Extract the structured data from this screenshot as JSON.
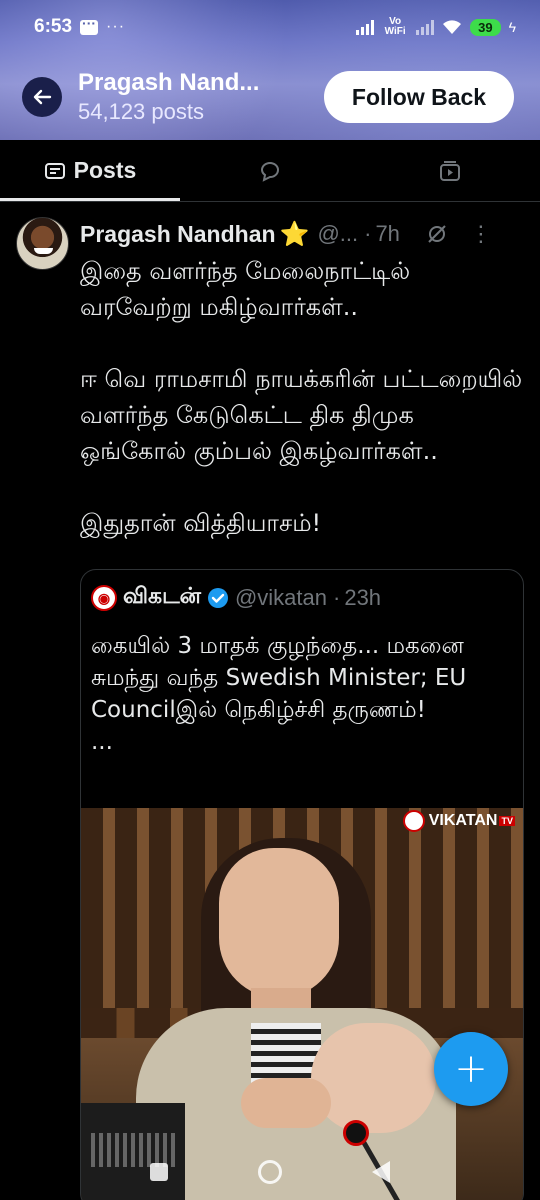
{
  "status_bar": {
    "time": "6:53",
    "network_label": "Vo WiFi",
    "battery": "39"
  },
  "header": {
    "profile_name": "Pragash Nand...",
    "post_count": "54,123 posts",
    "follow_label": "Follow Back"
  },
  "tabs": [
    {
      "label": "Posts",
      "icon": "posts-icon",
      "active": true
    },
    {
      "label": "",
      "icon": "replies-icon",
      "active": false
    },
    {
      "label": "",
      "icon": "media-icon",
      "active": false
    }
  ],
  "post": {
    "author": "Pragash Nandhan",
    "badge": "⭐",
    "handle": "@...",
    "separator": "·",
    "time": "7h",
    "body": "இதை வளர்ந்த மேலைநாட்டில் வரவேற்று மகிழ்வார்கள்..\n\nஈ வெ ராமசாமி நாயக்கரின் பட்டறையில் வளர்ந்த கேடுகெட்ட திக திமுக ஒங்கோல் கும்பல் இகழ்வார்கள்..\n\nஇதுதான் வித்தியாசம்!"
  },
  "quote": {
    "name": "விகடன்",
    "handle": "@vikatan",
    "separator": "·",
    "time": "23h",
    "body": "கையில் 3 மாதக் குழந்தை... மகனை சுமந்து வந்த Swedish Minister; EU Councilஇல் நெகிழ்ச்சி தருணம்!\n...",
    "media_watermark": "VIKATAN",
    "media_watermark_badge": "TV"
  },
  "fab": {
    "label": "+"
  },
  "colors": {
    "accent": "#1d9bf0",
    "background": "#000000",
    "muted": "#71767b"
  }
}
